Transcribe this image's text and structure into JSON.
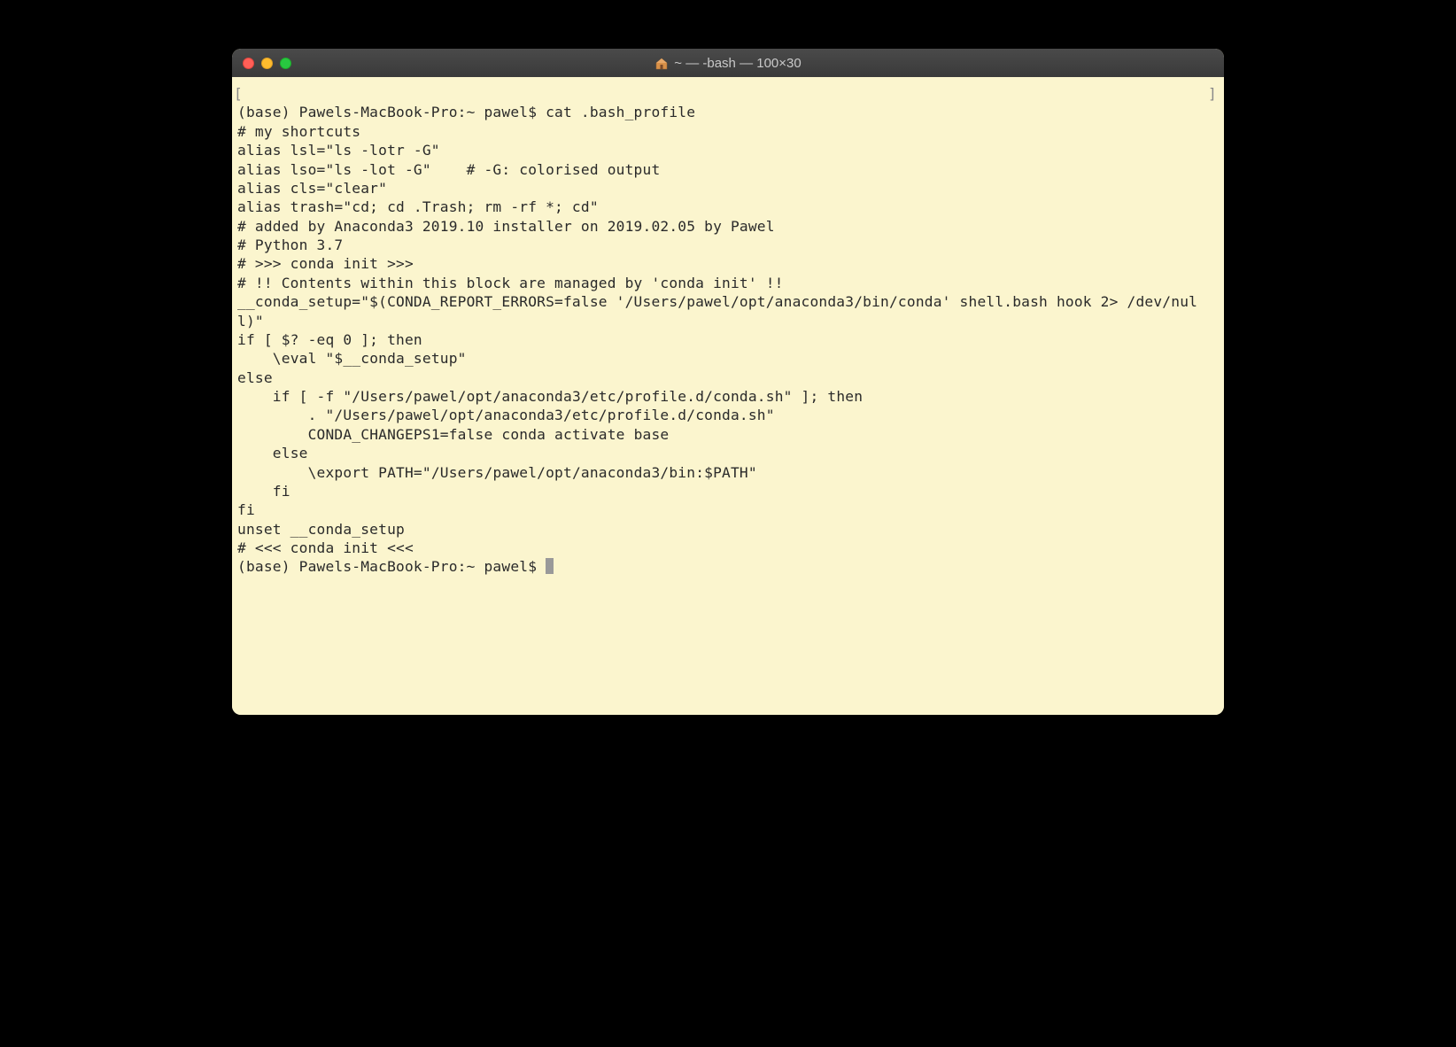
{
  "window": {
    "title": "~ — -bash — 100×30",
    "icon": "home-folder-icon"
  },
  "traffic_lights": {
    "close": "close",
    "minimize": "minimize",
    "maximize": "maximize"
  },
  "terminal": {
    "lines": [
      "(base) Pawels-MacBook-Pro:~ pawel$ cat .bash_profile",
      "# my shortcuts",
      "alias lsl=\"ls -lotr -G\"",
      "alias lso=\"ls -lot -G\"    # -G: colorised output",
      "alias cls=\"clear\"",
      "alias trash=\"cd; cd .Trash; rm -rf *; cd\"",
      "",
      "# added by Anaconda3 2019.10 installer on 2019.02.05 by Pawel",
      "# Python 3.7",
      "# >>> conda init >>>",
      "# !! Contents within this block are managed by 'conda init' !!",
      "__conda_setup=\"$(CONDA_REPORT_ERRORS=false '/Users/pawel/opt/anaconda3/bin/conda' shell.bash hook 2> /dev/null)\"",
      "if [ $? -eq 0 ]; then",
      "    \\eval \"$__conda_setup\"",
      "else",
      "    if [ -f \"/Users/pawel/opt/anaconda3/etc/profile.d/conda.sh\" ]; then",
      "        . \"/Users/pawel/opt/anaconda3/etc/profile.d/conda.sh\"",
      "        CONDA_CHANGEPS1=false conda activate base",
      "    else",
      "        \\export PATH=\"/Users/pawel/opt/anaconda3/bin:$PATH\"",
      "    fi",
      "fi",
      "unset __conda_setup",
      "# <<< conda init <<<"
    ],
    "prompt": "(base) Pawels-MacBook-Pro:~ pawel$ ",
    "bracket_left": "[",
    "bracket_right": "]"
  }
}
